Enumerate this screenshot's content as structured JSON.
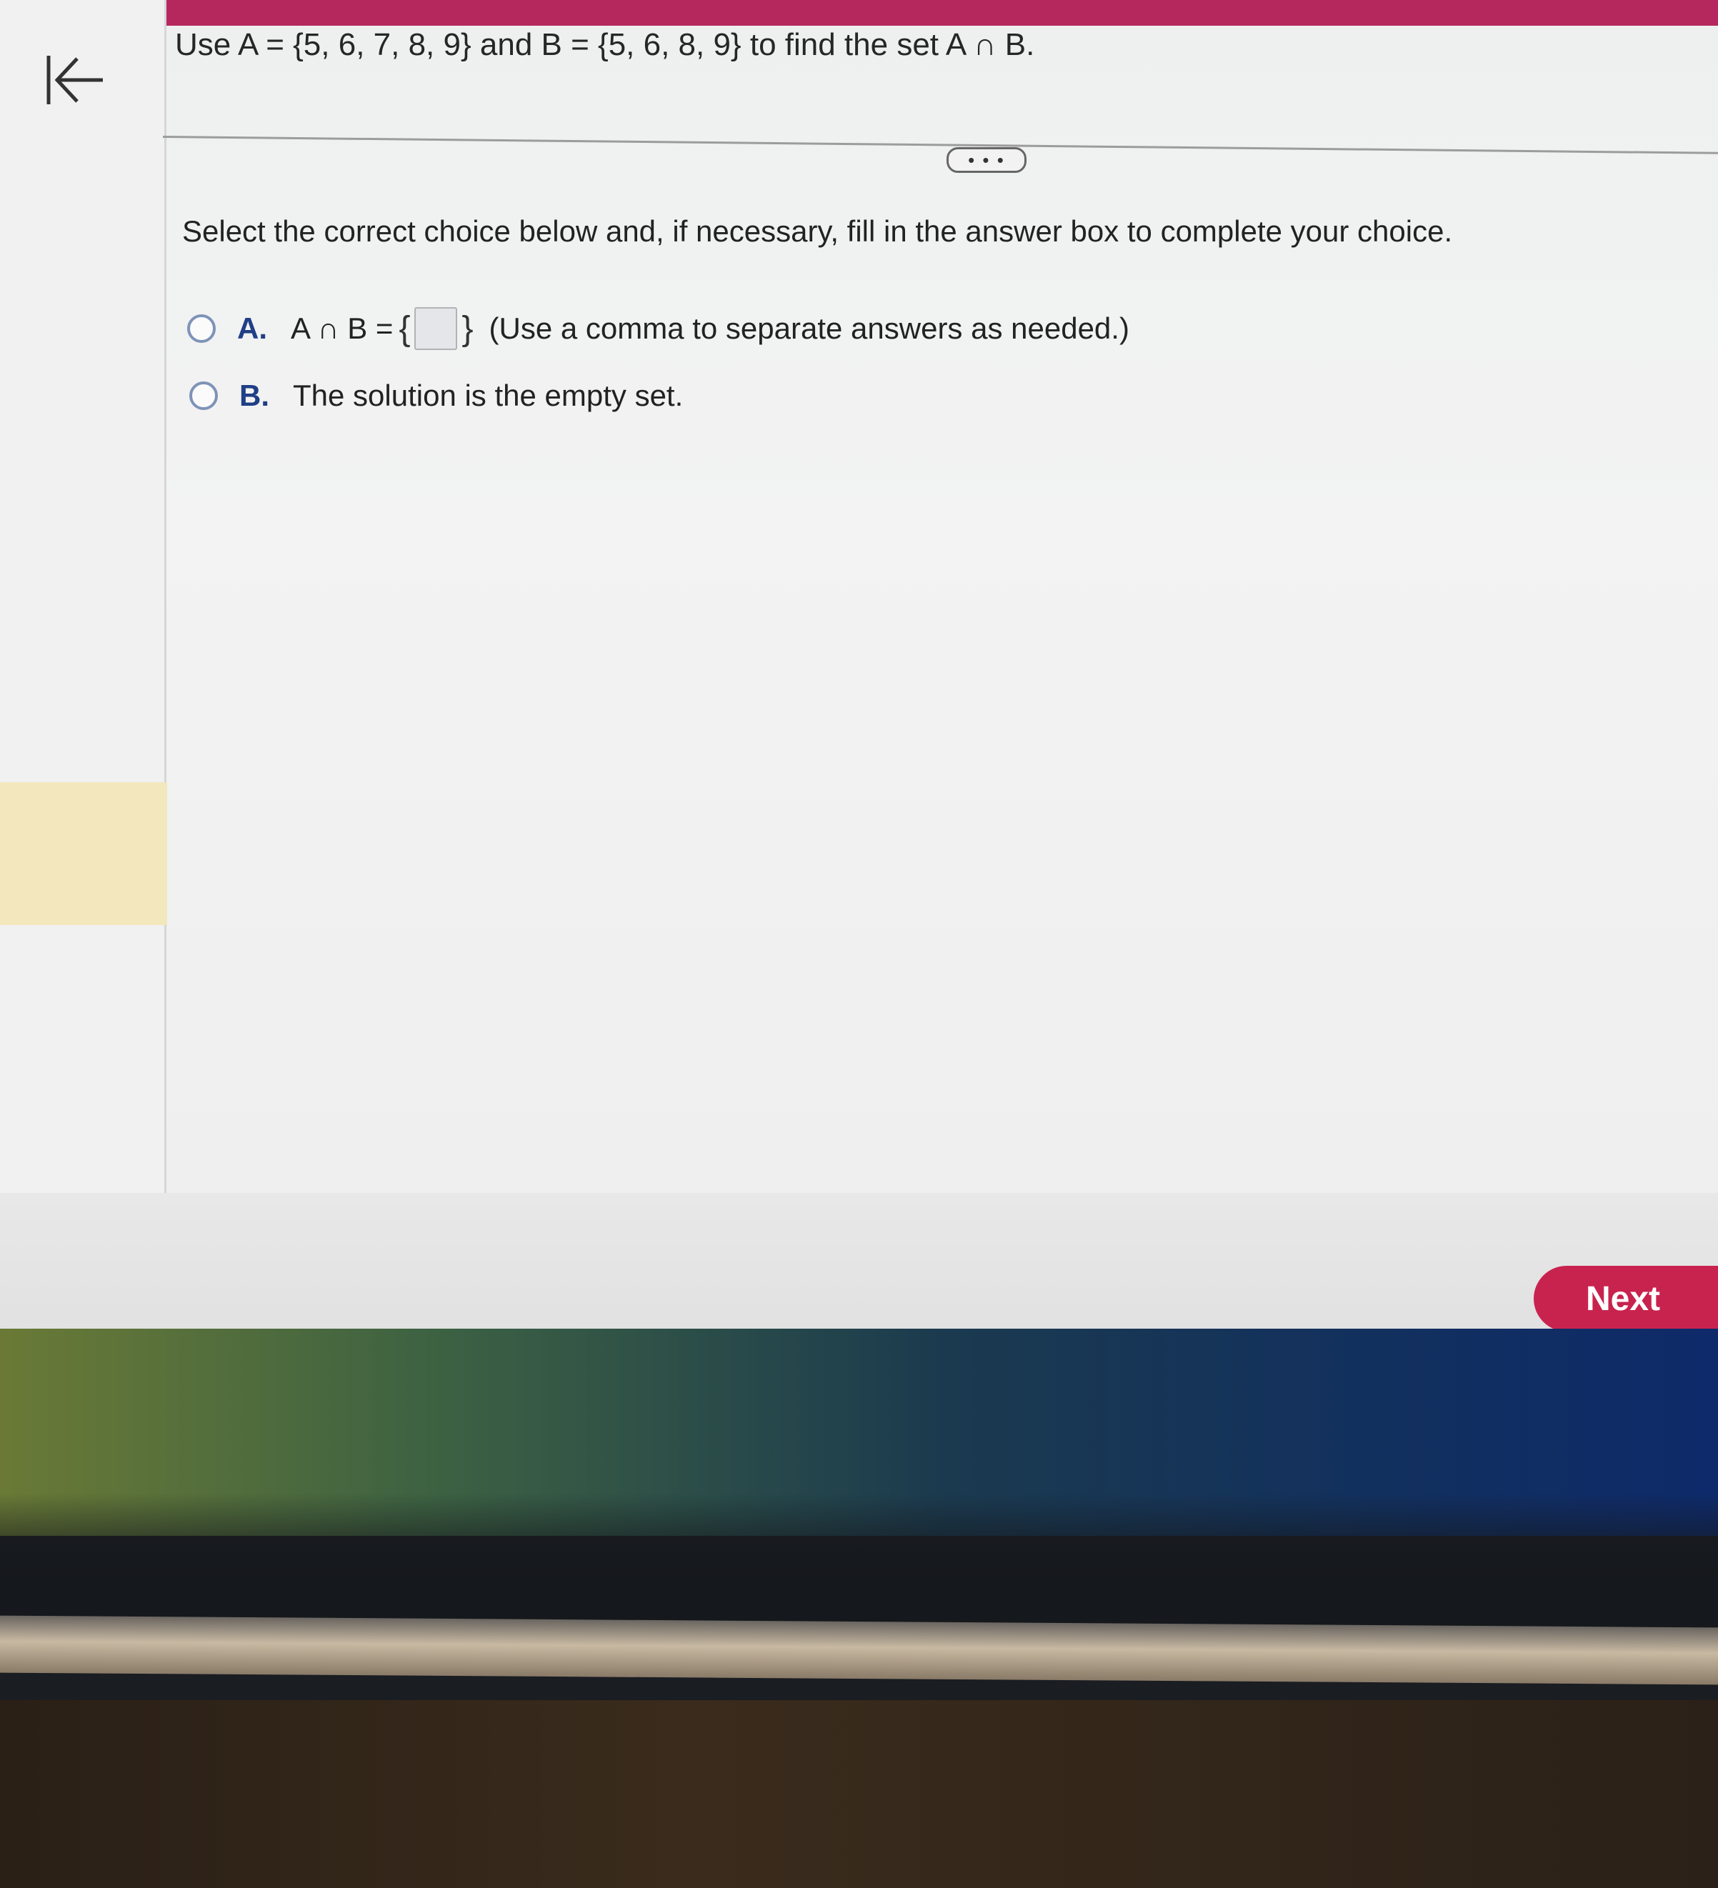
{
  "question": {
    "text": "Use A = {5, 6, 7, 8, 9} and B = {5, 6, 8, 9} to find the set A ∩ B."
  },
  "expand_button": {
    "label": "• • •"
  },
  "instruction": "Select the correct choice below and, if necessary, fill in the answer box to complete your choice.",
  "choices": [
    {
      "letter": "A.",
      "expression": "A ∩ B =",
      "brace_open": "{",
      "brace_close": "}",
      "answer_value": "",
      "hint": "(Use a comma to separate answers as needed.)"
    },
    {
      "letter": "B.",
      "text": "The solution is the empty set."
    }
  ],
  "footer": {
    "next_label": "Next"
  },
  "colors": {
    "topbar": "#b5285e",
    "next_button": "#c8234e",
    "choice_letter": "#1f3f86",
    "sidebar_highlight": "#f3e7bd"
  },
  "icons": {
    "back": "back-to-start-icon"
  }
}
